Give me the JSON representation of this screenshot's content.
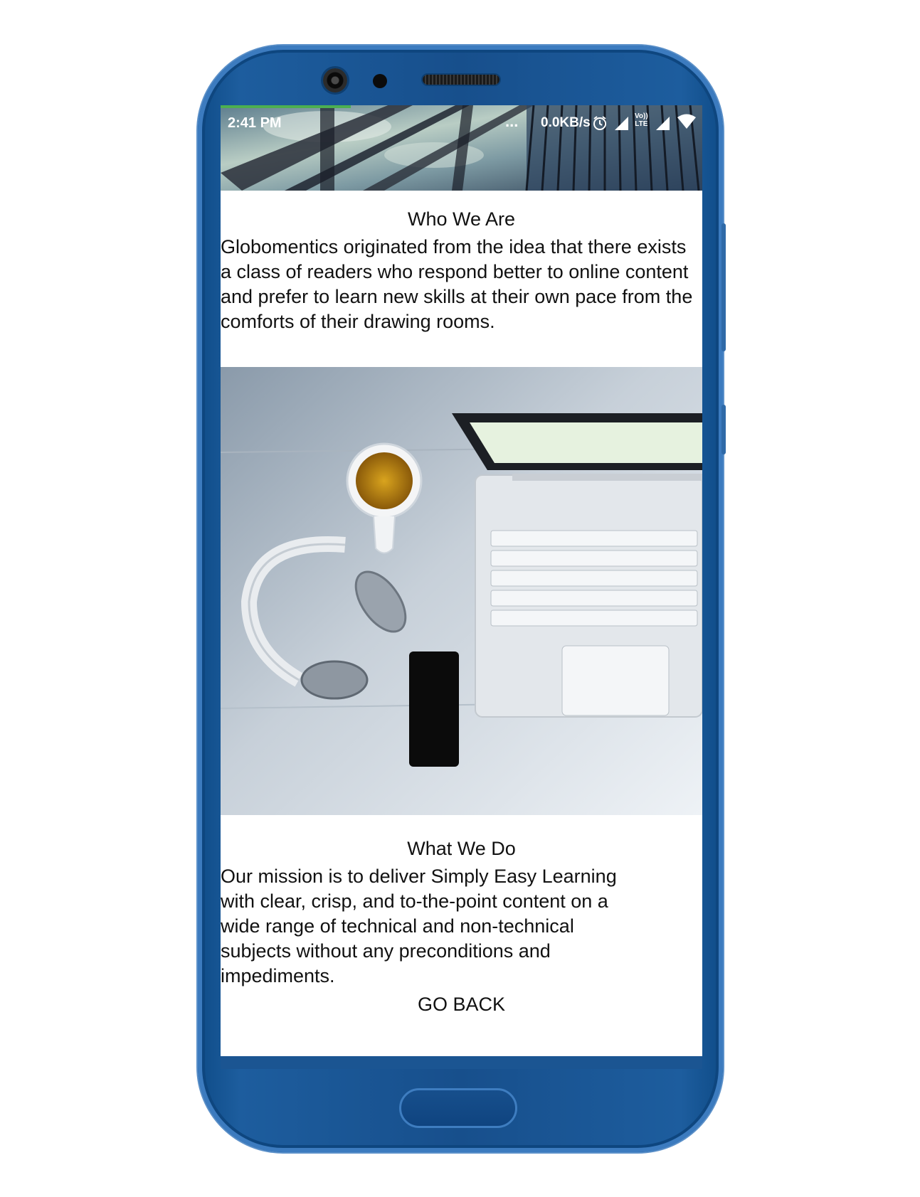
{
  "status_bar": {
    "time": "2:41 PM",
    "overflow": "...",
    "net_speed": "0.0KB/s",
    "volte": "Vo))",
    "lte": "LTE",
    "icons": [
      "alarm-icon",
      "signal-icon",
      "signal-icon",
      "wifi-icon"
    ]
  },
  "page": {
    "progress_percent": 27,
    "accent_color": "#4caf50",
    "sections": [
      {
        "heading": "Who We Are",
        "body": "Globomentics originated from the idea that there exists a class of readers who respond better to online content and prefer to learn new skills at their own pace from the comforts of their drawing rooms."
      },
      {
        "heading": "What We Do",
        "body": "Our mission is to deliver Simply Easy Learning with clear, crisp, and to-the-point content on a wide range of technical and non-technical subjects without any preconditions and impediments."
      }
    ],
    "go_back_label": "GO BACK"
  },
  "device": {
    "frame_color": "#1d5d9e"
  }
}
